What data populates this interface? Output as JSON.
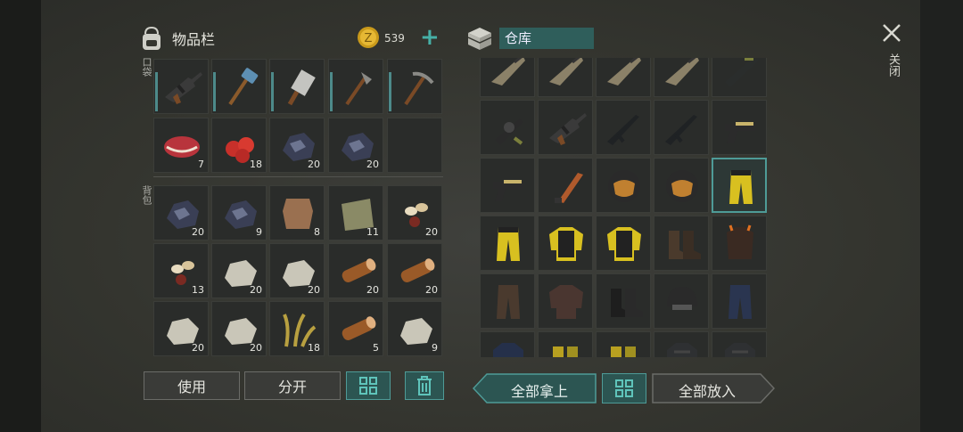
{
  "inventory": {
    "title": "物品栏",
    "coins": "539",
    "pocket_label": "口袋",
    "backpack_label": "背包"
  },
  "storage": {
    "title": "仓库"
  },
  "close_label": "关闭",
  "buttons": {
    "use": "使用",
    "split": "分开",
    "take_all": "全部拿上",
    "put_all": "全部放入"
  },
  "pocket_slots": [
    {
      "icon": "assault-rifle-icon",
      "count": ""
    },
    {
      "icon": "sledgehammer-icon",
      "count": ""
    },
    {
      "icon": "cleaver-icon",
      "count": ""
    },
    {
      "icon": "hatchet-icon",
      "count": ""
    },
    {
      "icon": "pickaxe-icon",
      "count": ""
    },
    {
      "icon": "raw-meat-icon",
      "count": "7"
    },
    {
      "icon": "berries-icon",
      "count": "18"
    },
    {
      "icon": "iron-ore-icon",
      "count": "20"
    },
    {
      "icon": "iron-ore-icon",
      "count": "20"
    },
    {
      "icon": "empty-slot",
      "count": ""
    }
  ],
  "backpack_slots": [
    {
      "icon": "iron-ore-icon",
      "count": "20"
    },
    {
      "icon": "iron-ore-icon",
      "count": "9"
    },
    {
      "icon": "leather-hide-icon",
      "count": "8"
    },
    {
      "icon": "cloth-icon",
      "count": "11"
    },
    {
      "icon": "seeds-icon",
      "count": "20"
    },
    {
      "icon": "seeds-icon",
      "count": "13"
    },
    {
      "icon": "stone-icon",
      "count": "20"
    },
    {
      "icon": "stone-icon",
      "count": "20"
    },
    {
      "icon": "wood-log-icon",
      "count": "20"
    },
    {
      "icon": "wood-log-icon",
      "count": "20"
    },
    {
      "icon": "stone-icon",
      "count": "20"
    },
    {
      "icon": "stone-icon",
      "count": "20"
    },
    {
      "icon": "plant-fiber-icon",
      "count": "18"
    },
    {
      "icon": "wood-log-icon",
      "count": "5"
    },
    {
      "icon": "stone-icon",
      "count": "9"
    }
  ],
  "storage_slots": [
    {
      "icon": "rifle-icon"
    },
    {
      "icon": "rifle-icon"
    },
    {
      "icon": "rifle-icon"
    },
    {
      "icon": "rifle-icon"
    },
    {
      "icon": "rocket-launcher-icon"
    },
    {
      "icon": "grenade-launcher-icon"
    },
    {
      "icon": "assault-rifle-icon"
    },
    {
      "icon": "m16-rifle-icon"
    },
    {
      "icon": "m16-rifle-icon"
    },
    {
      "icon": "pistol-icon"
    },
    {
      "icon": "pistol-icon"
    },
    {
      "icon": "machete-icon"
    },
    {
      "icon": "helmet-visor-icon"
    },
    {
      "icon": "helmet-visor-icon"
    },
    {
      "icon": "yellow-pants-icon"
    },
    {
      "icon": "yellow-pants-icon"
    },
    {
      "icon": "yellow-jacket-icon"
    },
    {
      "icon": "yellow-jacket-icon"
    },
    {
      "icon": "boots-icon"
    },
    {
      "icon": "orange-armor-icon"
    },
    {
      "icon": "brown-pants-icon"
    },
    {
      "icon": "brown-armor-icon"
    },
    {
      "icon": "black-boots-icon"
    },
    {
      "icon": "combat-helmet-icon"
    },
    {
      "icon": "blue-jeans-icon"
    },
    {
      "icon": "blue-vest-icon"
    },
    {
      "icon": "yellow-boots-icon"
    },
    {
      "icon": "yellow-boots-icon"
    },
    {
      "icon": "dark-armor-icon"
    },
    {
      "icon": "dark-armor-icon"
    }
  ],
  "colors": {
    "accent": "#4e9b97",
    "panel": "#2a2c2a",
    "background": "#35362f"
  }
}
